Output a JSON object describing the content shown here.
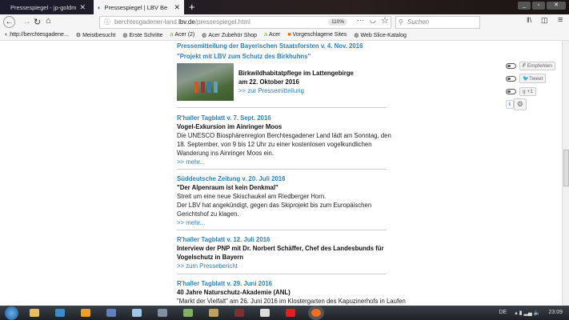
{
  "tabs": [
    {
      "label": "Pressespiegel - jp-goldmanns W"
    },
    {
      "label": "Pressespiegel | LBV Berchtesgad"
    }
  ],
  "url": {
    "prefix": "berchtesgadener-land.",
    "domain": "lbv.de",
    "path": "/pressespiegel.html"
  },
  "zoom": "110%",
  "search_placeholder": "Suchen",
  "bookmarks": [
    "http://berchtesgadene...",
    "Meistbesucht",
    "Erste Schritte",
    "Acer (2)",
    "Acer Zubehör Shop",
    "Acer",
    "Vorgeschlagene Sites",
    "Web Slice-Katalog"
  ],
  "articles": [
    {
      "source": "Pressemitteilung der Bayerischen Staatsforsten v. 4. Nov. 2016",
      "subtitle": "\"Projekt mit LBV zum Schutz des Birkhuhns\"",
      "title": "Birkwildhabitatpflege im Lattengebirge",
      "title2": "am 22. Oktober 2016",
      "link": ">> zur Pressemitteilung"
    },
    {
      "source": "R'haller Tagblatt v. 7. Sept. 2016",
      "title": "Vogel-Exkursion im Ainringer Moos",
      "text": "Die UNESCO Biosphärenregion Berchtesgadener Land lädt am Sonntag, den 18. September, von 9 bis 12 Uhr zu einer kostenlosen vogelkundlichen Wanderung ins Ainringer Moos ein.",
      "link": ">> mehr..."
    },
    {
      "source": "Süddeutsche Zeitung v. 20. Juli 2016",
      "title": "\"Der Alpenraum ist kein Denkmal\"",
      "text": "Streit um eine neue Skischaukel am Riedberger Horn.",
      "text2": "Der LBV hat angekündigt, gegen das Skiprojekt bis zum Europäischen Gerichtshof zu klagen.",
      "link": ">> mehr..."
    },
    {
      "source": "R'haller Tagblatt v. 12. Juli 2016",
      "title": "Interview der PNP mit Dr. Norbert Schäffer, Chef des Landesbunds für Vogelschutz in Bayern",
      "link": ">> zum Pressebericht"
    },
    {
      "source": "R'haller Tagblatt v. 29. Juni 2016",
      "title": "40 Jahre Naturschutz-Akademie (ANL)",
      "text": "\"Markt der Vielfalt\" am 26. Juni 2016 im Klostergarten des Kapuzinerhofs in Laufen"
    }
  ],
  "social": {
    "facebook": "Empfehlen",
    "twitter": "Tweet",
    "gplus": "+1"
  },
  "tray": {
    "lang": "DE",
    "time": "23:09"
  }
}
